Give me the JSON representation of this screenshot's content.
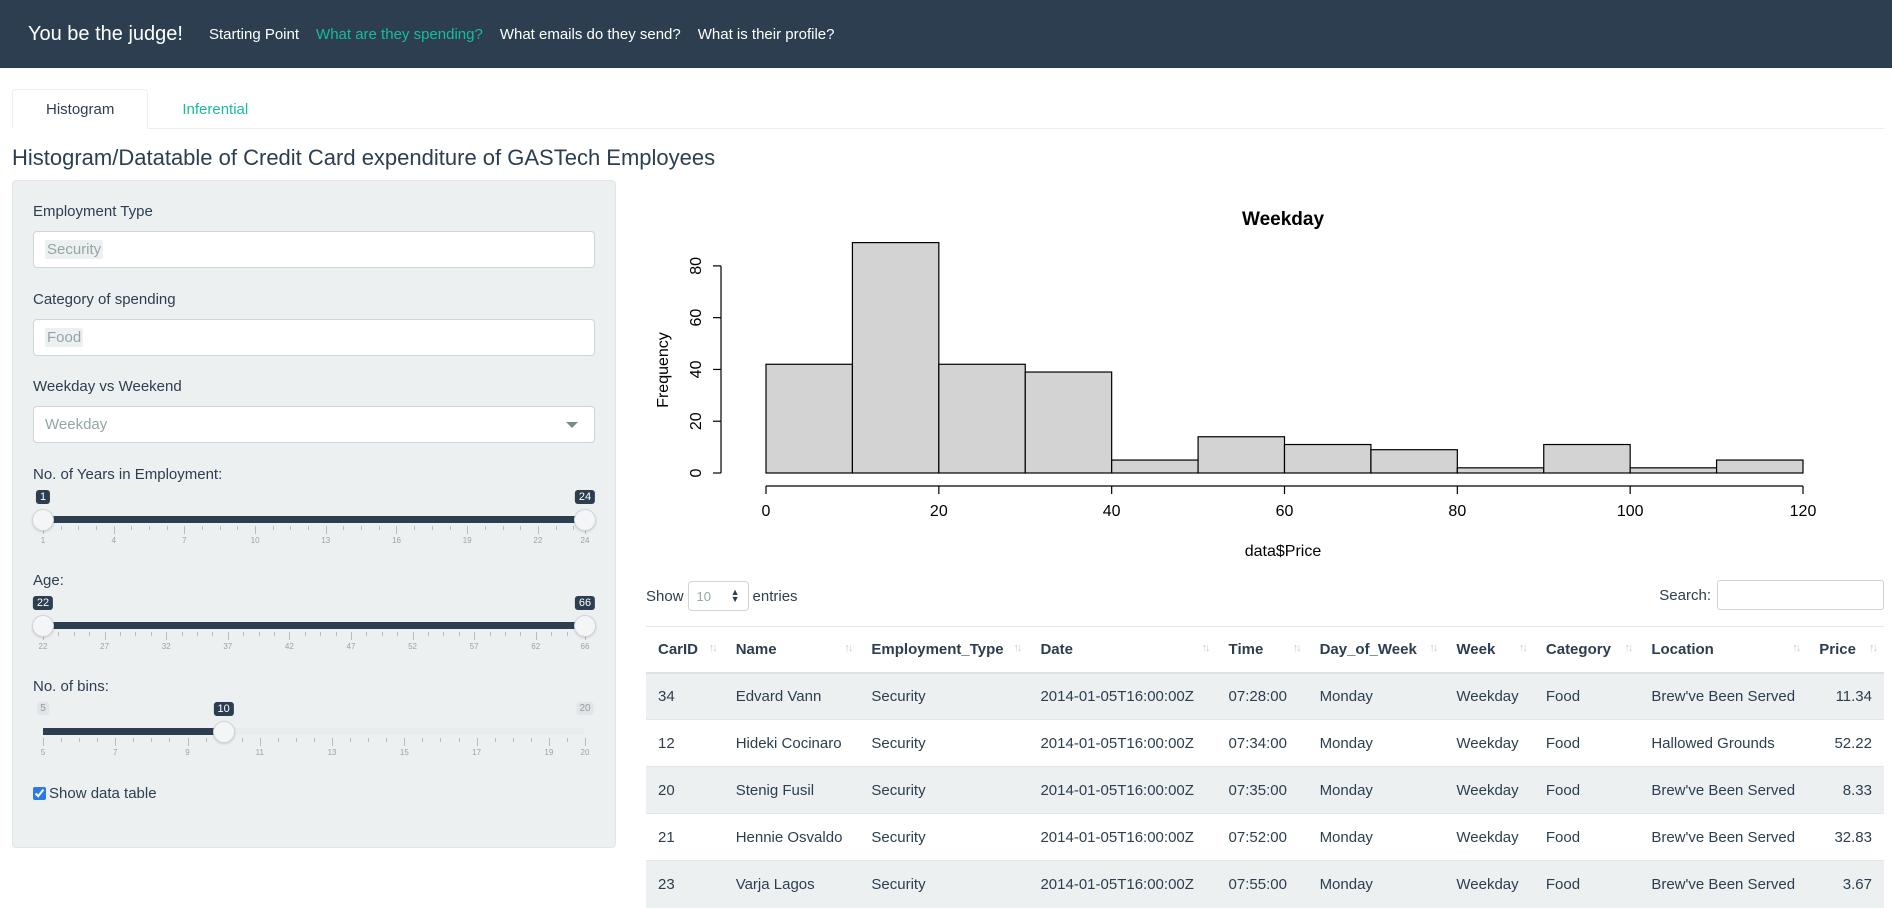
{
  "navbar": {
    "brand": "You be the judge!",
    "links": [
      {
        "label": "Starting Point"
      },
      {
        "label": "What are they spending?"
      },
      {
        "label": "What emails do they send?"
      },
      {
        "label": "What is their profile?"
      }
    ]
  },
  "tabs": [
    {
      "label": "Histogram"
    },
    {
      "label": "Inferential"
    }
  ],
  "page_title": "Histogram/Datatable of Credit Card expenditure of GASTech Employees",
  "sidebar": {
    "employment_type": {
      "label": "Employment Type",
      "value": "Security"
    },
    "category": {
      "label": "Category of spending",
      "value": "Food"
    },
    "weekday": {
      "label": "Weekday vs Weekend",
      "value": "Weekday"
    },
    "years_slider": {
      "label": "No. of Years in Employment:",
      "min": 1,
      "max": 24,
      "from": 1,
      "to": 24,
      "from_label": "1",
      "to_label": "24",
      "ticks": [
        "1",
        "4",
        "7",
        "10",
        "13",
        "16",
        "19",
        "22",
        "24"
      ]
    },
    "age_slider": {
      "label": "Age:",
      "min": 22,
      "max": 66,
      "from": 22,
      "to": 66,
      "from_label": "22",
      "to_label": "66",
      "ticks": [
        "22",
        "27",
        "32",
        "37",
        "42",
        "47",
        "52",
        "57",
        "62",
        "66"
      ]
    },
    "bins_slider": {
      "label": "No. of bins:",
      "min": 5,
      "max": 20,
      "value": 10,
      "min_label": "5",
      "max_label": "20",
      "value_label": "10",
      "ticks": [
        "5",
        "7",
        "9",
        "11",
        "13",
        "15",
        "17",
        "19",
        "20"
      ]
    },
    "show_table": {
      "label": "Show data table",
      "checked": true
    }
  },
  "chart_data": {
    "type": "bar",
    "title": "Weekday",
    "xlabel": "data$Price",
    "ylabel": "Frequency",
    "bin_edges": [
      0,
      10,
      20,
      30,
      40,
      50,
      60,
      70,
      80,
      90,
      100,
      110,
      120
    ],
    "values": [
      42,
      89,
      42,
      39,
      5,
      14,
      11,
      9,
      2,
      11,
      2,
      5
    ],
    "xlim": [
      0,
      120
    ],
    "ylim": [
      0,
      90
    ],
    "x_ticks": [
      "0",
      "20",
      "40",
      "60",
      "80",
      "100",
      "120"
    ],
    "y_ticks": [
      "0",
      "20",
      "40",
      "60",
      "80"
    ],
    "bar_color": "#d3d3d3"
  },
  "table": {
    "show_label": "Show",
    "entries_label": "entries",
    "length_value": "10",
    "search_label": "Search:",
    "columns": [
      "CarID",
      "Name",
      "Employment_Type",
      "Date",
      "Time",
      "Day_of_Week",
      "Week",
      "Category",
      "Location",
      "Price"
    ],
    "rows": [
      [
        "34",
        "Edvard Vann",
        "Security",
        "2014-01-05T16:00:00Z",
        "07:28:00",
        "Monday",
        "Weekday",
        "Food",
        "Brew've Been Served",
        "11.34"
      ],
      [
        "12",
        "Hideki Cocinaro",
        "Security",
        "2014-01-05T16:00:00Z",
        "07:34:00",
        "Monday",
        "Weekday",
        "Food",
        "Hallowed Grounds",
        "52.22"
      ],
      [
        "20",
        "Stenig Fusil",
        "Security",
        "2014-01-05T16:00:00Z",
        "07:35:00",
        "Monday",
        "Weekday",
        "Food",
        "Brew've Been Served",
        "8.33"
      ],
      [
        "21",
        "Hennie Osvaldo",
        "Security",
        "2014-01-05T16:00:00Z",
        "07:52:00",
        "Monday",
        "Weekday",
        "Food",
        "Brew've Been Served",
        "32.83"
      ],
      [
        "23",
        "Varja Lagos",
        "Security",
        "2014-01-05T16:00:00Z",
        "07:55:00",
        "Monday",
        "Weekday",
        "Food",
        "Brew've Been Served",
        "3.67"
      ]
    ]
  },
  "colors": {
    "navbar": "#2c3e50",
    "accent": "#18bc9c",
    "panel": "#ecf0f1"
  }
}
